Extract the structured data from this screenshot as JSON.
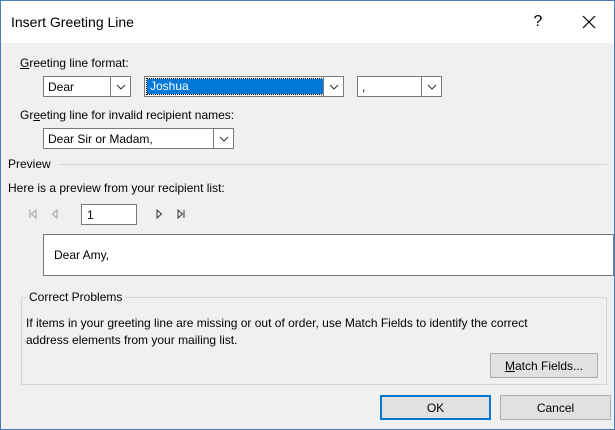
{
  "dialog": {
    "title": "Insert Greeting Line",
    "help_label": "?",
    "close_label": "✕"
  },
  "greeting_format": {
    "label_prefix": "G",
    "label_rest": "reeting line format:",
    "salutation": "Dear",
    "name_format": "Joshua",
    "punctuation": ","
  },
  "invalid_names": {
    "label_a": "Gr",
    "label_u": "e",
    "label_b": "eting line for invalid recipient names:",
    "value": "Dear Sir or Madam,"
  },
  "preview": {
    "section_label": "Preview",
    "description": "Here is a preview from your recipient list:",
    "record_number": "1",
    "preview_text": "Dear Amy,"
  },
  "correct_problems": {
    "group_label": "Correct Problems",
    "description_line1": "If items in your greeting line are missing or out of order, use Match Fields to identify the correct",
    "description_line2": "address elements from your mailing list.",
    "match_fields_u": "M",
    "match_fields_rest": "atch Fields..."
  },
  "footer": {
    "ok_label": "OK",
    "cancel_label": "Cancel"
  },
  "colors": {
    "accent": "#0078d7",
    "dialog_bg": "#f0f0f0",
    "window_border": "#4a7ab8"
  }
}
